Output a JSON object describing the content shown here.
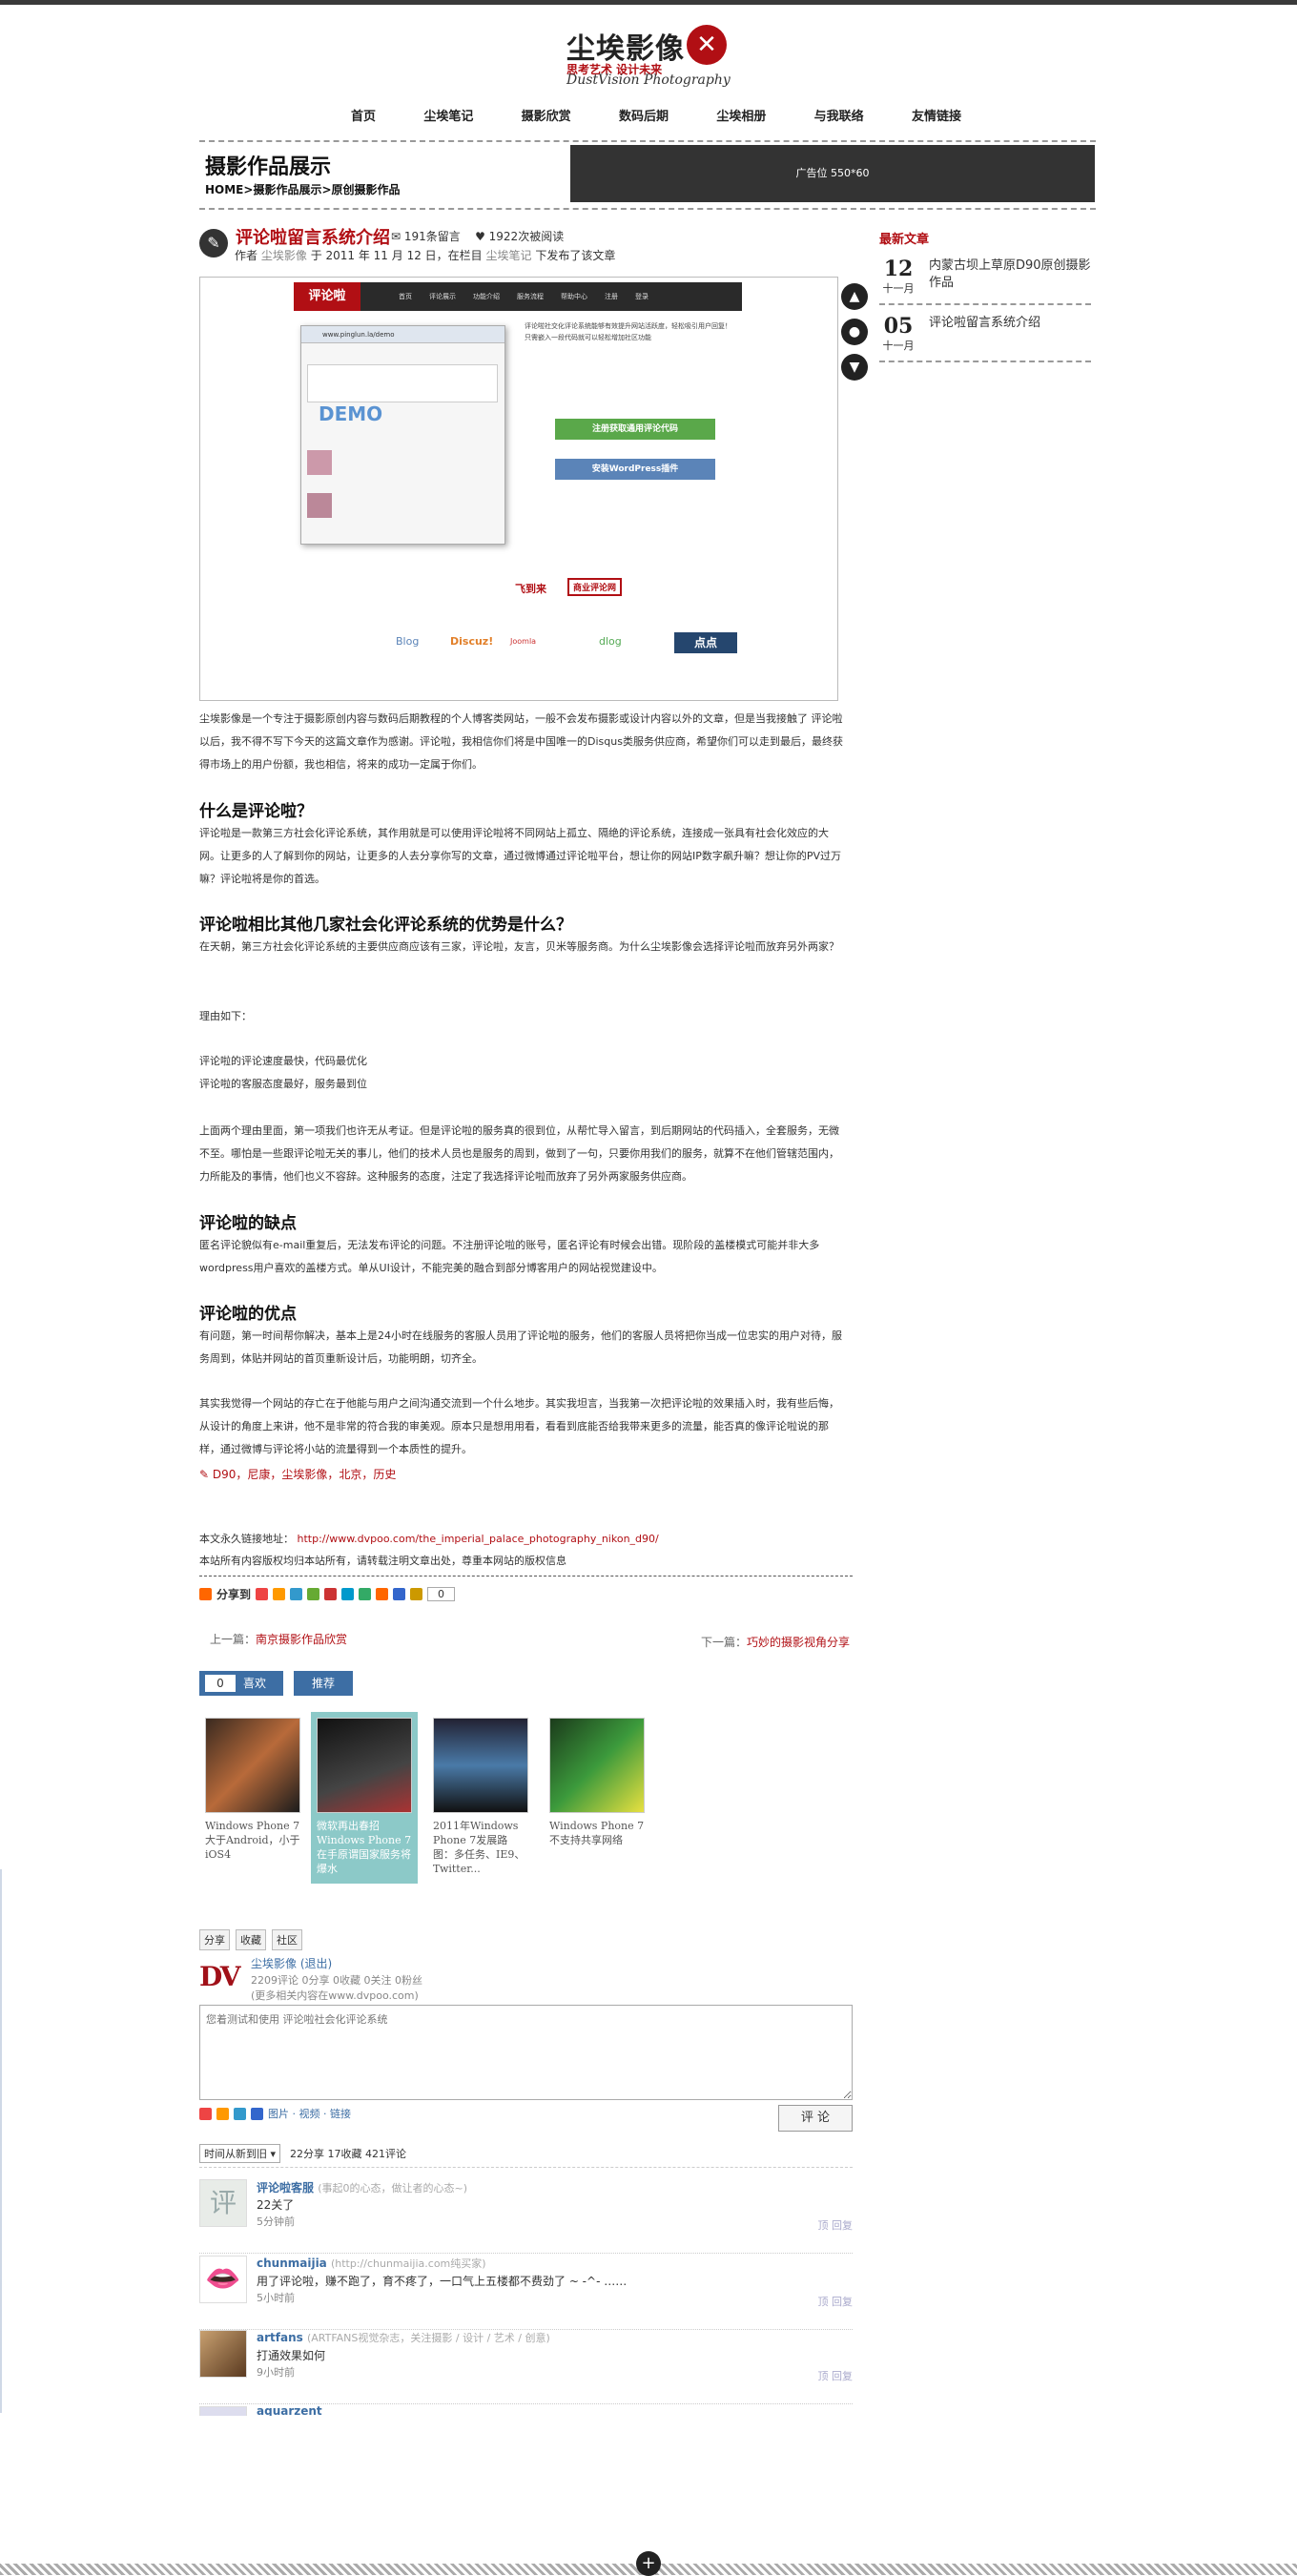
{
  "site": {
    "logo_cn": "尘埃影像",
    "slogan": "思考艺术 设计未来",
    "logo_en": "DustVision Photography"
  },
  "nav": [
    "首页",
    "尘埃笔记",
    "摄影欣赏",
    "数码后期",
    "尘埃相册",
    "与我联络",
    "友情链接"
  ],
  "header": {
    "title": "摄影作品展示",
    "breadcrumb": "HOME>摄影作品展示>原创摄影作品",
    "ad": "广告位 550*60"
  },
  "post": {
    "title": "评论啦留言系统介绍",
    "comments_count": "191条留言",
    "views": "1922次被阅读",
    "author_prefix": "作者",
    "author": "尘埃影像",
    "date_text": "于 2011 年 11 月 12 日，在栏目",
    "category": "尘埃笔记",
    "posted_suffix": "下发布了该文章",
    "intro": "尘埃影像是一个专注于摄影原创内容与数码后期教程的个人博客类网站，一般不会发布摄影或设计内容以外的文章，但是当我接触了 评论啦 以后，我不得不写下今天的这篇文章作为感谢。评论啦，我相信你们将是中国唯一的Disqus类服务供应商，希望你们可以走到最后，最终获得市场上的用户份额，我也相信，将来的成功一定属于你们。",
    "h_what": "什么是评论啦？",
    "p_what": "评论啦是一款第三方社会化评论系统，其作用就是可以使用评论啦将不同网站上孤立、隔绝的评论系统，连接成一张具有社会化效应的大网。让更多的人了解到你的网站，让更多的人去分享你写的文章，通过微博通过评论啦平台，想让你的网站IP数字飙升嘛？想让你的PV过万嘛？评论啦将是你的首选。",
    "h_adv": "评论啦相比其他几家社会化评论系统的优势是什么？",
    "p_adv": "在天朝，第三方社会化评论系统的主要供应商应该有三家，评论啦，友言，贝米等服务商。为什么尘埃影像会选择评论啦而放弃另外两家？",
    "reason_label": "理由如下：",
    "reason1": "评论啦的评论速度最快，代码最优化",
    "reason2": "评论啦的客服态度最好，服务最到位",
    "p_service": "上面两个理由里面，第一项我们也许无从考证。但是评论啦的服务真的很到位，从帮忙导入留言，到后期网站的代码插入，全套服务，无微不至。哪怕是一些跟评论啦无关的事儿，他们的技术人员也是服务的周到，做到了一句，只要你用我们的服务，就算不在他们管辖范围内，力所能及的事情，他们也义不容辞。这种服务的态度，注定了我选择评论啦而放弃了另外两家服务供应商。",
    "h_weak": "评论啦的缺点",
    "p_weak": "匿名评论貌似有e-mail重复后，无法发布评论的问题。不注册评论啦的账号，匿名评论有时候会出错。现阶段的盖楼模式可能并非大多wordpress用户喜欢的盖楼方式。单从UI设计，不能完美的融合到部分博客用户的网站视觉建设中。",
    "h_good": "评论啦的优点",
    "p_good": "有问题，第一时间帮你解决，基本上是24小时在线服务的客服人员用了评论啦的服务，他们的客服人员将把你当成一位忠实的用户对待，服务周到，体贴并网站的首页重新设计后，功能明朗，切齐全。",
    "p_final": "其实我觉得一个网站的存亡在于他能与用户之间沟通交流到一个什么地步。其实我坦言，当我第一次把评论啦的效果插入时，我有些后悔，从设计的角度上来讲，他不是非常的符合我的审美观。原本只是想用用看，看看到底能否给我带来更多的流量，能否真的像评论啦说的那样，通过微博与评论将小站的流量得到一个本质性的提升。",
    "tags": "D90，尼康，尘埃影像，北京，历史",
    "permalink_label": "本文永久链接地址：",
    "permalink": "http://www.dvpoo.com/the_imperial_palace_photography_nikon_d90/",
    "copyright": "本站所有内容版权均归本站所有，请转载注明文章出处，尊重本网站的版权信息"
  },
  "screenshot": {
    "brand": "评论啦",
    "menu": [
      "首页",
      "评论展示",
      "功能介绍",
      "服务流程",
      "帮助中心",
      "注册",
      "登录"
    ],
    "url": "www.pinglun.la/demo",
    "demo": "DEMO",
    "desc1": "评论啦社交化评论系统能够有效提升网站活跃度，轻松吸引用户回复！",
    "desc2": "只需嵌入一段代码就可以轻松增加社区功能",
    "btn_register": "注册获取通用评论代码",
    "btn_wp": "安装WordPress插件",
    "logos_row2": [
      "Blog",
      "Discuz!",
      "Joomla",
      "dlog",
      "点点"
    ],
    "logos_row1": [
      "飞到来",
      "商业评论网"
    ]
  },
  "share": {
    "label": "分享到",
    "count": "0",
    "colors": [
      "#e44",
      "#f90",
      "#39c",
      "#6a3",
      "#c33",
      "#09c",
      "#3a6",
      "#f60",
      "#36c",
      "#c90"
    ]
  },
  "navpost": {
    "prev_label": "上一篇：",
    "prev": "南京摄影作品欣赏",
    "next_label": "下一篇：",
    "next": "巧妙的摄影视角分享"
  },
  "like": {
    "count": "0",
    "label": "喜欢",
    "recommend": "推荐"
  },
  "related": [
    "Windows Phone 7大于Android，小于iOS4",
    "微软再出春招Windows Phone 7在手原谓国家服务将爆水",
    "2011年Windows Phone 7发展路图：多任务、IE9、Twitter...",
    "Windows Phone 7不支持共享网络"
  ],
  "comment_box": {
    "share": "分享",
    "fav": "收藏",
    "community": "社区",
    "user": "尘埃影像",
    "logout": "(退出)",
    "stats": "2209评论 0分享 0收藏 0关注 0粉丝",
    "sync": "(更多相关内容在www.dvpoo.com)",
    "placeholder": "您着测试和使用 评论啦社会化评论系统",
    "tools": "图片 · 视频 · 链接",
    "submit": "评 论",
    "sort": "时间从新到旧",
    "summary": "22分享 17收藏 421评论"
  },
  "comments": [
    {
      "name": "评论啦客服",
      "desc": "(事起0的心态，做让者的心态~)",
      "text": "22关了",
      "time": "5分钟前",
      "action": "顶  回复"
    },
    {
      "name": "chunmaijia",
      "desc": "(http://chunmaijia.com纯买家)",
      "text": "用了评论啦，赚不跑了，育不疼了，一口气上五楼都不费劲了 ~ -^- ……",
      "time": "5小时前",
      "action": "顶  回复"
    },
    {
      "name": "artfans",
      "desc": "(ARTFANS视觉杂志，关注摄影 / 设计 / 艺术 / 创意)",
      "text": "打通效果如何",
      "time": "9小时前",
      "action": "顶  回复"
    },
    {
      "name": "aquarzent",
      "desc": "",
      "text": "",
      "time": "",
      "action": ""
    }
  ],
  "sidebar": {
    "title": "最新文章",
    "items": [
      {
        "day": "12",
        "month": "十一月",
        "title": "内蒙古坝上草原D90原创摄影作品"
      },
      {
        "day": "05",
        "month": "十一月",
        "title": "评论啦留言系统介绍"
      }
    ]
  }
}
